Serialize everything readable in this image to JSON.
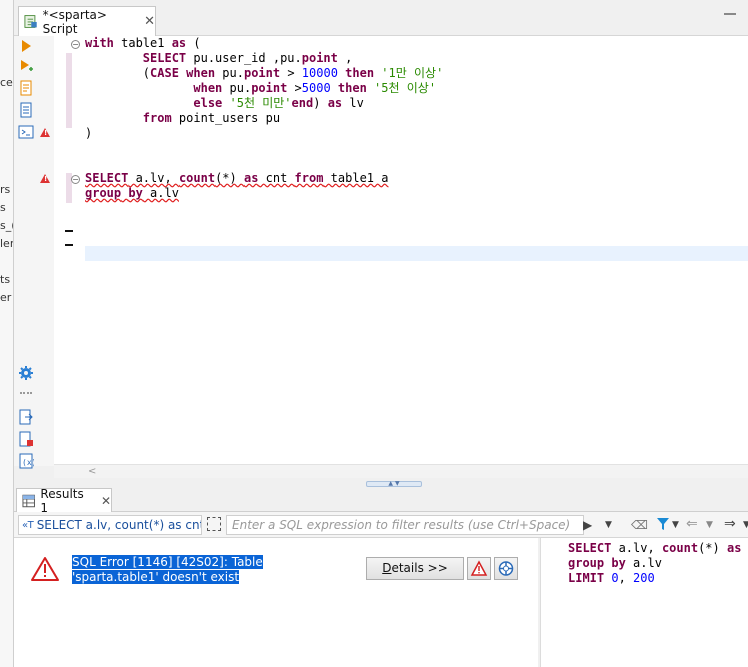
{
  "editor_tab": {
    "label": "*<sparta> Script",
    "close": "✕"
  },
  "left_panel": {
    "fragments": [
      "ce",
      "rs",
      "s",
      "s_(",
      "ler",
      "ts",
      "er"
    ]
  },
  "code": {
    "lines": [
      [
        {
          "t": "with",
          "c": "kw"
        },
        {
          "t": " table1 "
        },
        {
          "t": "as",
          "c": "kw"
        },
        {
          "t": " ("
        }
      ],
      [
        {
          "t": "        "
        },
        {
          "t": "SELECT",
          "c": "kw"
        },
        {
          "t": " pu.user_id ,pu."
        },
        {
          "t": "point",
          "c": "kw"
        },
        {
          "t": " ,"
        }
      ],
      [
        {
          "t": "        ("
        },
        {
          "t": "CASE",
          "c": "kw"
        },
        {
          "t": " "
        },
        {
          "t": "when",
          "c": "kw"
        },
        {
          "t": " pu."
        },
        {
          "t": "point",
          "c": "kw"
        },
        {
          "t": " > "
        },
        {
          "t": "10000",
          "c": "num"
        },
        {
          "t": " "
        },
        {
          "t": "then",
          "c": "kw"
        },
        {
          "t": " "
        },
        {
          "t": "'1만 이상'",
          "c": "str"
        }
      ],
      [
        {
          "t": "               "
        },
        {
          "t": "when",
          "c": "kw"
        },
        {
          "t": " pu."
        },
        {
          "t": "point",
          "c": "kw"
        },
        {
          "t": " >"
        },
        {
          "t": "5000",
          "c": "num"
        },
        {
          "t": " "
        },
        {
          "t": "then",
          "c": "kw"
        },
        {
          "t": " "
        },
        {
          "t": "'5천 이상'",
          "c": "str"
        }
      ],
      [
        {
          "t": "               "
        },
        {
          "t": "else",
          "c": "kw"
        },
        {
          "t": " "
        },
        {
          "t": "'5천 미만'",
          "c": "str"
        },
        {
          "t": "end",
          "c": "kw"
        },
        {
          "t": ") "
        },
        {
          "t": "as",
          "c": "kw"
        },
        {
          "t": " lv"
        }
      ],
      [
        {
          "t": "        "
        },
        {
          "t": "from",
          "c": "kw"
        },
        {
          "t": " point_users pu"
        }
      ],
      [
        {
          "t": ")"
        }
      ],
      [],
      [],
      [
        {
          "t": "SELECT",
          "c": "kw err"
        },
        {
          "t": " a.lv, ",
          "c": "err"
        },
        {
          "t": "count",
          "c": "fn err"
        },
        {
          "t": "(*) ",
          "c": "err"
        },
        {
          "t": "as",
          "c": "kw err"
        },
        {
          "t": " cnt ",
          "c": "err"
        },
        {
          "t": "from",
          "c": "kw err"
        },
        {
          "t": " table1 a",
          "c": "err"
        }
      ],
      [
        {
          "t": "group",
          "c": "kw err"
        },
        {
          "t": " ",
          "c": "err"
        },
        {
          "t": "by",
          "c": "kw err"
        },
        {
          "t": " a.lv",
          "c": "err"
        }
      ]
    ]
  },
  "results": {
    "tab_label": "Results 1",
    "tab_close": "✕",
    "query_chip": "SELECT a.lv, count(*) as cnt fr",
    "filter_placeholder": "Enter a SQL expression to filter results (use Ctrl+Space)",
    "error_message": "SQL Error [1146] [42S02]: Table 'sparta.table1' doesn't exist",
    "details_label": "Details >>",
    "details_underline": "D",
    "details_rest": "etails >>",
    "query_preview": [
      [
        {
          "t": "SELECT",
          "c": "kw"
        },
        {
          "t": " a.lv, "
        },
        {
          "t": "count",
          "c": "fn"
        },
        {
          "t": "(*) "
        },
        {
          "t": "as",
          "c": "kw"
        },
        {
          "t": " c"
        }
      ],
      [
        {
          "t": "group",
          "c": "kw"
        },
        {
          "t": " "
        },
        {
          "t": "by",
          "c": "kw"
        },
        {
          "t": " a.lv"
        }
      ],
      [
        {
          "t": "LIMIT",
          "c": "kw"
        },
        {
          "t": " "
        },
        {
          "t": "0",
          "c": "num"
        },
        {
          "t": ", "
        },
        {
          "t": "200",
          "c": "num"
        }
      ]
    ]
  },
  "colors": {
    "keyword": "#7a0047",
    "number": "#0000ff",
    "string": "#2a8a00",
    "selection": "#0a64d6",
    "error": "#e02020"
  }
}
